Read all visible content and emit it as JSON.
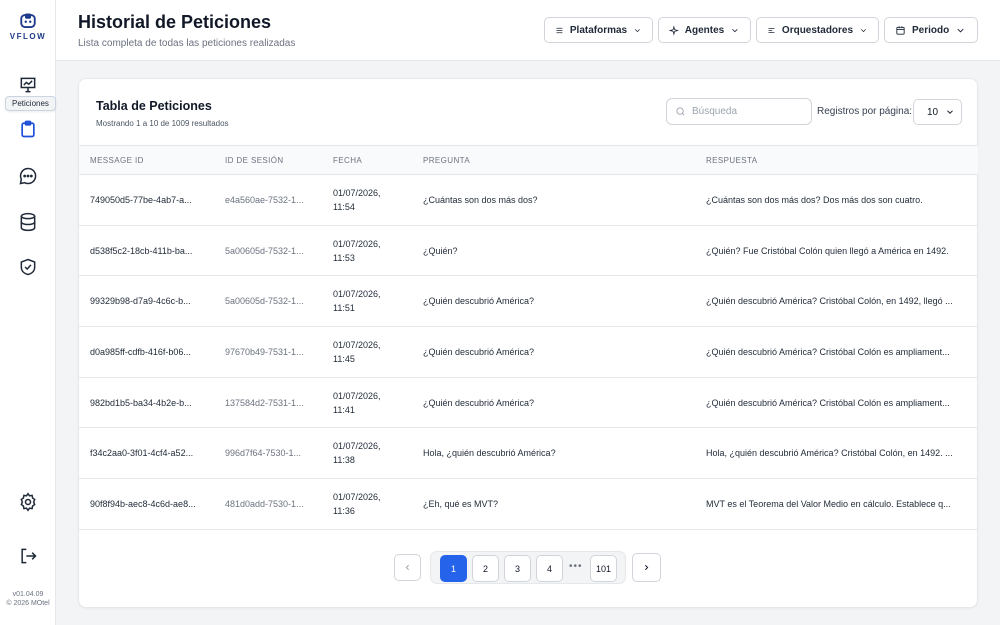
{
  "app": {
    "brand": "VFLOW",
    "version": "v01.04.09",
    "copyright": "© 2026 MOtel"
  },
  "sidebar": {
    "tooltip": "Peticiones",
    "items": [
      {
        "name": "analytics",
        "icon": "chart-presentation-icon"
      },
      {
        "name": "peticiones",
        "icon": "clipboard-icon",
        "active": true
      },
      {
        "name": "chat",
        "icon": "chat-bubble-icon"
      },
      {
        "name": "database",
        "icon": "database-icon"
      },
      {
        "name": "security",
        "icon": "shield-check-icon"
      },
      {
        "name": "settings",
        "icon": "gear-icon"
      },
      {
        "name": "logout",
        "icon": "logout-icon"
      }
    ]
  },
  "header": {
    "title": "Historial de Peticiones",
    "subtitle": "Lista completa de todas las peticiones realizadas",
    "filters": {
      "plataformas": "Plataformas",
      "agentes": "Agentes",
      "orquestadores": "Orquestadores",
      "periodo": "Periodo"
    }
  },
  "table_card": {
    "title": "Tabla de Peticiones",
    "subtitle": "Mostrando 1 a 10 de 1009 resultados",
    "search_placeholder": "Búsqueda",
    "per_page_label": "Registros por página:",
    "per_page_value": "10",
    "columns": [
      "MESSAGE ID",
      "ID DE SESIÓN",
      "FECHA",
      "PREGUNTA",
      "RESPUESTA"
    ],
    "rows": [
      {
        "message_id": "749050d5-77be-4ab7-a...",
        "session_id": "e4a560ae-7532-1...",
        "date": "01/07/2026,",
        "time": "11:54",
        "question": "¿Cuántas son dos más dos?",
        "answer": "¿Cuántas son dos más dos? Dos más dos son cuatro."
      },
      {
        "message_id": "d538f5c2-18cb-411b-ba...",
        "session_id": "5a00605d-7532-1...",
        "date": "01/07/2026,",
        "time": "11:53",
        "question": "¿Quién?",
        "answer": "¿Quién? Fue Cristóbal Colón quien llegó a América en 1492."
      },
      {
        "message_id": "99329b98-d7a9-4c6c-b...",
        "session_id": "5a00605d-7532-1...",
        "date": "01/07/2026,",
        "time": "11:51",
        "question": "¿Quién descubrió América?",
        "answer": "¿Quién descubrió América? Cristóbal Colón, en 1492, llegó ..."
      },
      {
        "message_id": "d0a985ff-cdfb-416f-b06...",
        "session_id": "97670b49-7531-1...",
        "date": "01/07/2026,",
        "time": "11:45",
        "question": "¿Quién descubrió América?",
        "answer": "¿Quién descubrió América? Cristóbal Colón es ampliament..."
      },
      {
        "message_id": "982bd1b5-ba34-4b2e-b...",
        "session_id": "137584d2-7531-1...",
        "date": "01/07/2026,",
        "time": "11:41",
        "question": "¿Quién descubrió América?",
        "answer": "¿Quién descubrió América? Cristóbal Colón es ampliament..."
      },
      {
        "message_id": "f34c2aa0-3f01-4cf4-a52...",
        "session_id": "996d7f64-7530-1...",
        "date": "01/07/2026,",
        "time": "11:38",
        "question": "Hola, ¿quién descubrió América?",
        "answer": "Hola, ¿quién descubrió América? Cristóbal Colón, en 1492. ..."
      },
      {
        "message_id": "90f8f94b-aec8-4c6d-ae8...",
        "session_id": "481d0add-7530-1...",
        "date": "01/07/2026,",
        "time": "11:36",
        "question": "¿Eh, qué es MVT?",
        "answer": "MVT es el Teorema del Valor Medio en cálculo. Establece q..."
      }
    ],
    "pagination": {
      "pages": [
        "1",
        "2",
        "3",
        "4",
        "101"
      ],
      "current": "1",
      "ellipsis": "•••"
    }
  },
  "colors": {
    "accent": "#2563eb",
    "brand": "#1e3a8a"
  }
}
